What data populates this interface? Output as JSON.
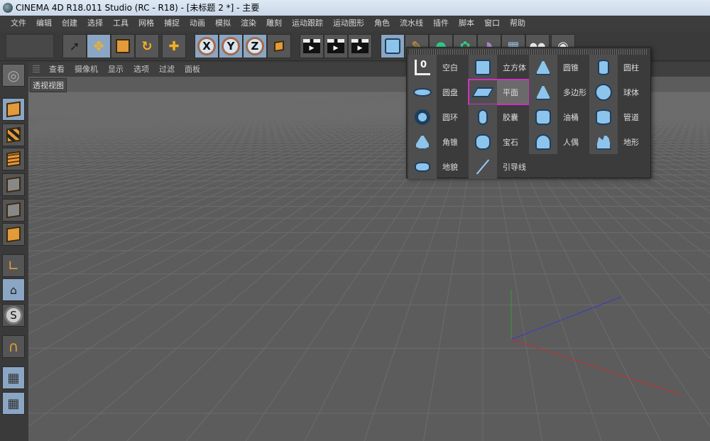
{
  "window": {
    "title": "CINEMA 4D R18.011 Studio (RC - R18) - [未标题 2 *] - 主要"
  },
  "menu": [
    "文件",
    "编辑",
    "创建",
    "选择",
    "工具",
    "网格",
    "捕捉",
    "动画",
    "模拟",
    "渲染",
    "雕刻",
    "运动跟踪",
    "运动图形",
    "角色",
    "流水线",
    "插件",
    "脚本",
    "窗口",
    "帮助"
  ],
  "toolbar": {
    "axes": [
      "X",
      "Y",
      "Z"
    ]
  },
  "viewport": {
    "menu": [
      "查看",
      "摄像机",
      "显示",
      "选项",
      "过滤",
      "面板"
    ],
    "label": "透视视图"
  },
  "popup": {
    "columns": [
      [
        {
          "label": "空白",
          "icon": "null-icon"
        },
        {
          "label": "圆盘",
          "icon": "disc-icon"
        },
        {
          "label": "圆环",
          "icon": "torus-icon"
        },
        {
          "label": "角锥",
          "icon": "pyramid-icon"
        },
        {
          "label": "地貌",
          "icon": "landscape-icon"
        }
      ],
      [
        {
          "label": "立方体",
          "icon": "cube-icon"
        },
        {
          "label": "平面",
          "icon": "plane-icon",
          "highlighted": true
        },
        {
          "label": "胶囊",
          "icon": "capsule-icon"
        },
        {
          "label": "宝石",
          "icon": "gem-icon"
        },
        {
          "label": "引导线",
          "icon": "guide-icon"
        }
      ],
      [
        {
          "label": "圆锥",
          "icon": "cone-icon"
        },
        {
          "label": "多边形",
          "icon": "polygon-icon"
        },
        {
          "label": "油桶",
          "icon": "oil-tank-icon"
        },
        {
          "label": "人偶",
          "icon": "figure-icon"
        }
      ],
      [
        {
          "label": "圆柱",
          "icon": "cylinder-icon"
        },
        {
          "label": "球体",
          "icon": "sphere-icon"
        },
        {
          "label": "管道",
          "icon": "tube-icon"
        },
        {
          "label": "地形",
          "icon": "terrain-icon"
        }
      ]
    ],
    "highlight_color": "#d030c0"
  }
}
